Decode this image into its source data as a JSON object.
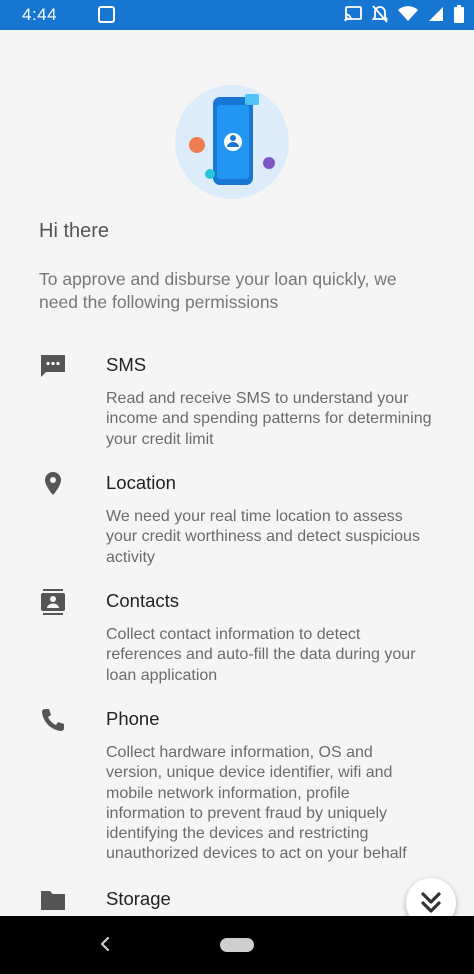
{
  "status_bar": {
    "time": "4:44",
    "background_color": "#1676d2",
    "icons": [
      "app-notification-icon",
      "cast-icon",
      "do-not-disturb-icon",
      "wifi-icon",
      "signal-icon",
      "battery-icon"
    ]
  },
  "page": {
    "greeting": "Hi there",
    "intro": "To approve and disburse your loan quickly, we need the following permissions"
  },
  "permissions": [
    {
      "icon": "sms-icon",
      "title": "SMS",
      "description": "Read and receive SMS to understand your income and spending patterns for determining your credit limit"
    },
    {
      "icon": "location-icon",
      "title": "Location",
      "description": "We need your real time location to assess your credit worthiness and detect suspicious activity"
    },
    {
      "icon": "contacts-icon",
      "title": "Contacts",
      "description": "Collect contact information to detect references and auto-fill the data during your loan application"
    },
    {
      "icon": "phone-icon",
      "title": "Phone",
      "description": "Collect hardware information, OS and version, unique device identifier, wifi and mobile network information, profile information to prevent fraud by uniquely identifying the devices and restricting unauthorized devices to act on your behalf"
    },
    {
      "icon": "folder-icon",
      "title": "Storage",
      "description": ""
    }
  ],
  "scroll_button": {
    "icon": "double-chevron-down-icon"
  },
  "nav_bar": {
    "back_icon": "back-icon",
    "home_icon": "home-pill-icon"
  }
}
